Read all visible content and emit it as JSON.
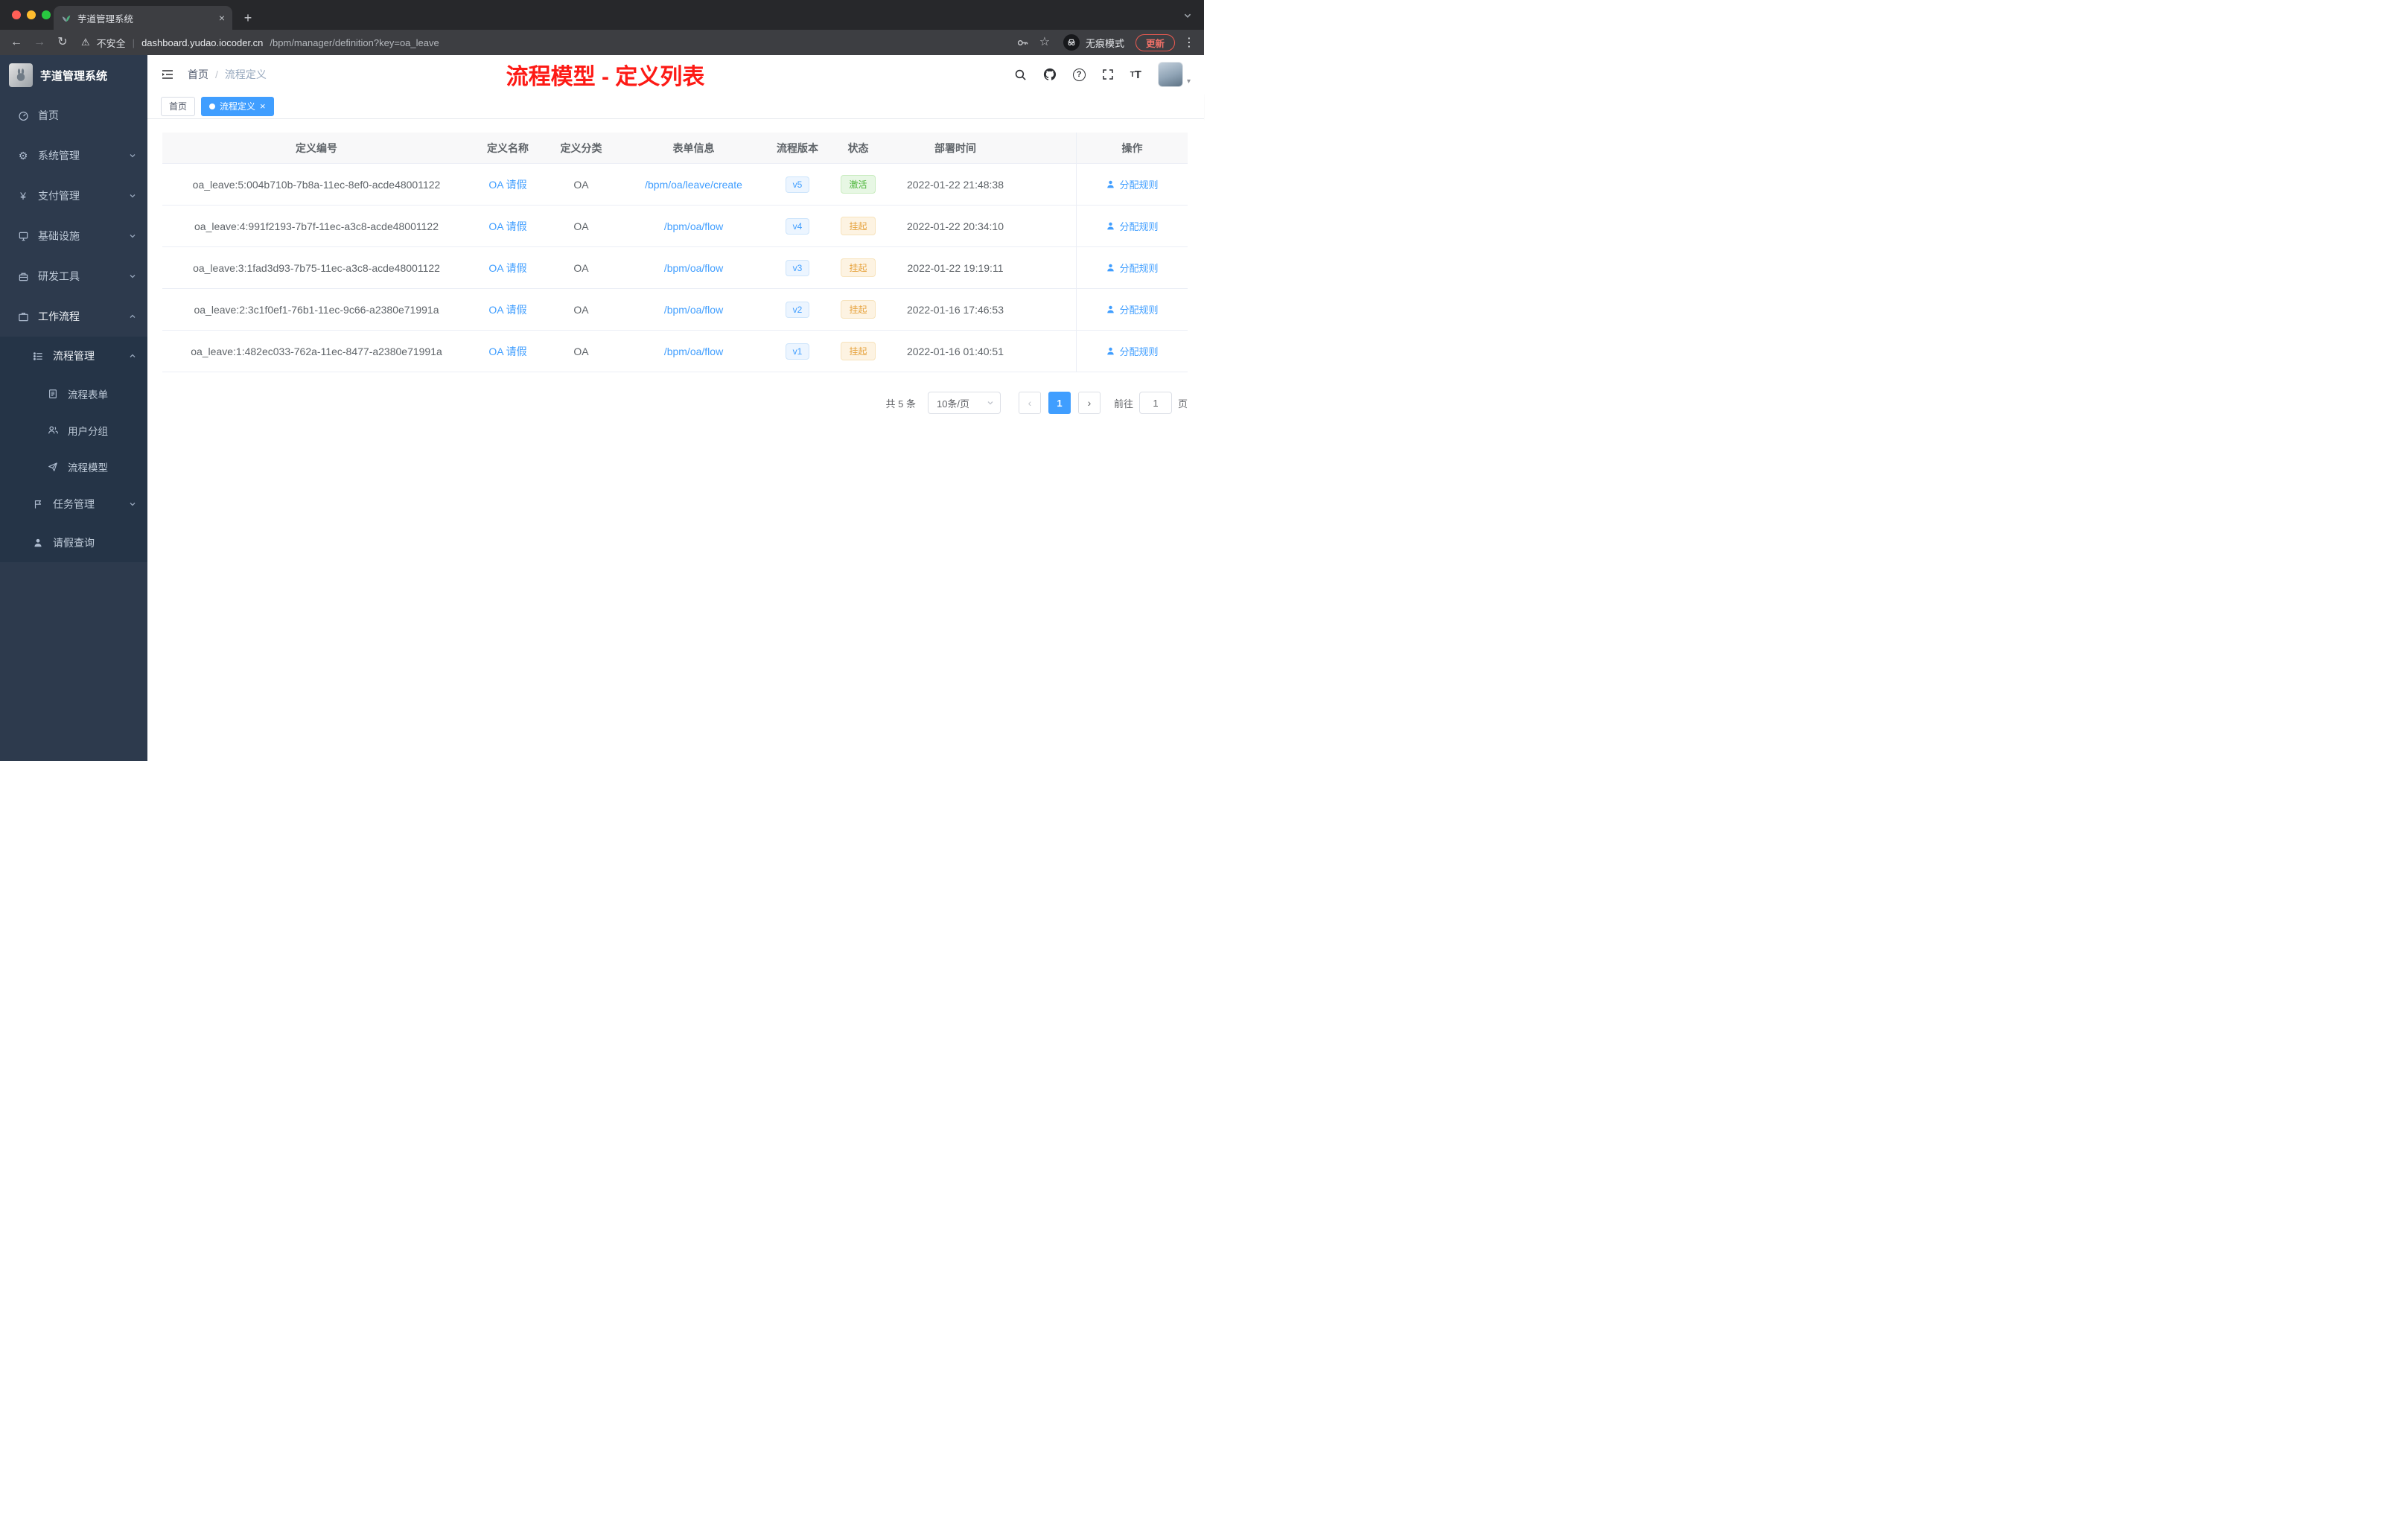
{
  "colors": {
    "accent": "#409eff",
    "success": "#49b436",
    "warning": "#e6a23c",
    "annotation_red": "#fd1a15",
    "sidebar_bg": "#2d3a4d"
  },
  "icons": {
    "back": "←",
    "forward": "→",
    "reload": "↻",
    "warning": "⚠",
    "star": "☆",
    "gear": "⚙",
    "menu_dots": "⋮",
    "plus": "+",
    "caret_down": "▾",
    "close": "×",
    "dash": "|"
  },
  "browser": {
    "tab_title": "芋道管理系统",
    "security_label": "不安全",
    "url_domain": "dashboard.yudao.iocoder.cn",
    "url_path": "/bpm/manager/definition?key=oa_leave",
    "incognito_label": "无痕模式",
    "update_label": "更新"
  },
  "sidebar": {
    "logo_title": "芋道管理系统",
    "items": [
      {
        "label": "首页"
      },
      {
        "label": "系统管理"
      },
      {
        "label": "支付管理"
      },
      {
        "label": "基础设施"
      },
      {
        "label": "研发工具"
      },
      {
        "label": "工作流程"
      },
      {
        "label": "流程管理"
      },
      {
        "label": "流程表单"
      },
      {
        "label": "用户分组"
      },
      {
        "label": "流程模型"
      },
      {
        "label": "任务管理"
      },
      {
        "label": "请假查询"
      }
    ]
  },
  "header": {
    "breadcrumb_home": "首页",
    "breadcrumb_sep": "/",
    "breadcrumb_current": "流程定义",
    "annotation": "流程模型 - 定义列表"
  },
  "tags": {
    "home": "首页",
    "active": "流程定义"
  },
  "table": {
    "columns": {
      "id": "定义编号",
      "name": "定义名称",
      "category": "定义分类",
      "form": "表单信息",
      "version": "流程版本",
      "status": "状态",
      "time": "部署时间",
      "action": "操作"
    },
    "rows": [
      {
        "id": "oa_leave:5:004b710b-7b8a-11ec-8ef0-acde48001122",
        "name": "OA 请假",
        "category": "OA",
        "form": "/bpm/oa/leave/create",
        "version": "v5",
        "status": "激活",
        "time": "2022-01-22 21:48:38",
        "action": "分配规则"
      },
      {
        "id": "oa_leave:4:991f2193-7b7f-11ec-a3c8-acde48001122",
        "name": "OA 请假",
        "category": "OA",
        "form": "/bpm/oa/flow",
        "version": "v4",
        "status": "挂起",
        "time": "2022-01-22 20:34:10",
        "action": "分配规则"
      },
      {
        "id": "oa_leave:3:1fad3d93-7b75-11ec-a3c8-acde48001122",
        "name": "OA 请假",
        "category": "OA",
        "form": "/bpm/oa/flow",
        "version": "v3",
        "status": "挂起",
        "time": "2022-01-22 19:19:11",
        "action": "分配规则"
      },
      {
        "id": "oa_leave:2:3c1f0ef1-76b1-11ec-9c66-a2380e71991a",
        "name": "OA 请假",
        "category": "OA",
        "form": "/bpm/oa/flow",
        "version": "v2",
        "status": "挂起",
        "time": "2022-01-16 17:46:53",
        "action": "分配规则"
      },
      {
        "id": "oa_leave:1:482ec033-762a-11ec-8477-a2380e71991a",
        "name": "OA 请假",
        "category": "OA",
        "form": "/bpm/oa/flow",
        "version": "v1",
        "status": "挂起",
        "time": "2022-01-16 01:40:51",
        "action": "分配规则"
      }
    ]
  },
  "pagination": {
    "total": "共 5 条",
    "page_size": "10条/页",
    "current_page": "1",
    "goto_label": "前往",
    "goto_value": "1",
    "page_unit": "页"
  }
}
